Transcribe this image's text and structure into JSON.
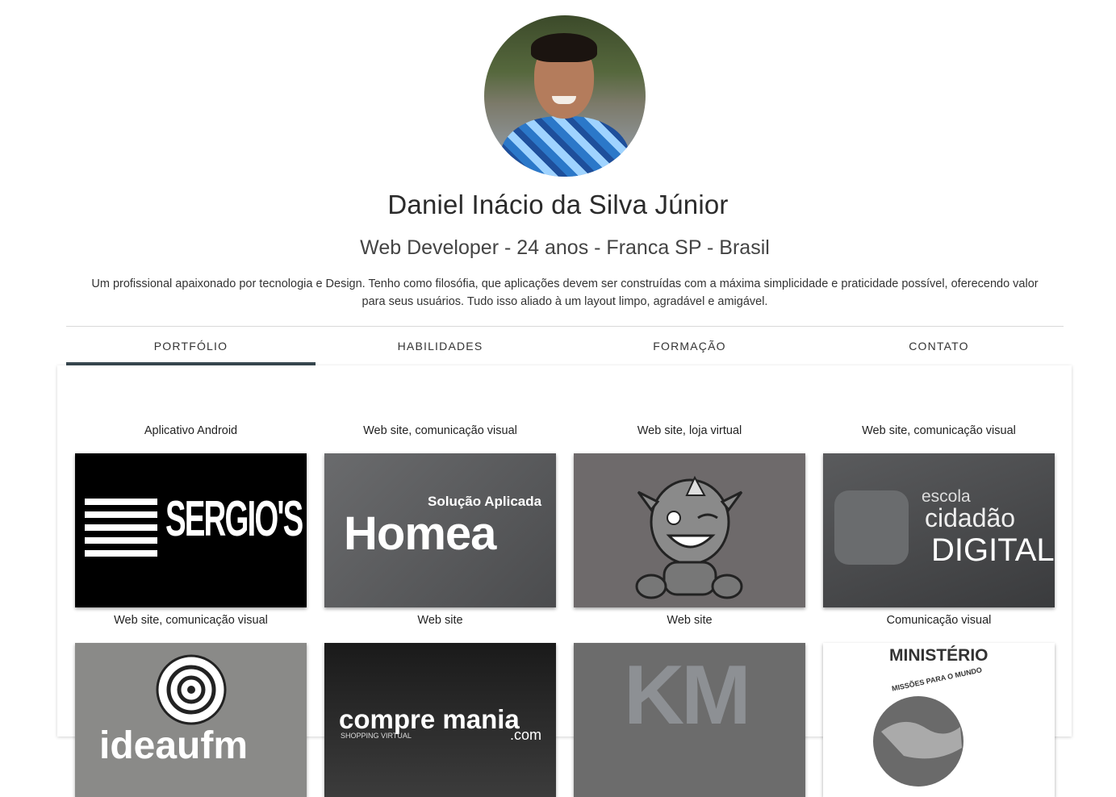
{
  "profile": {
    "name": "Daniel Inácio da Silva Júnior",
    "subtitle": "Web Developer - 24 anos - Franca SP - Brasil",
    "bio_line1": "Um profissional apaixonado por tecnologia e Design. Tenho como filosófia, que aplicações devem ser construídas com a máxima simplicidade e praticidade possível, oferecendo valor",
    "bio_line2": "para seus usuários. Tudo isso aliado à um layout limpo, agradável e amigável."
  },
  "tabs": [
    {
      "label": "PORTFÓLIO",
      "active": true
    },
    {
      "label": "HABILIDADES",
      "active": false
    },
    {
      "label": "FORMAÇÃO",
      "active": false
    },
    {
      "label": "CONTATO",
      "active": false
    }
  ],
  "portfolio": [
    {
      "caption": "Aplicativo Android",
      "logo": "SERGIO'S",
      "bg": "#000000"
    },
    {
      "caption": "Web site, comunicação visual",
      "logo": "Homea",
      "logo_sub": "Solução Aplicada",
      "bg": "#58595b"
    },
    {
      "caption": "Web site, loja virtual",
      "logo": "mascot",
      "bg": "#6e6a6b"
    },
    {
      "caption": "Web site, comunicação visual",
      "logo": "DIGITAL",
      "logo_sub": "escola",
      "logo_mid": "cidadão",
      "bg": "#4a4b4d"
    },
    {
      "caption": "Web site, comunicação visual",
      "logo": "ideaufm",
      "bg": "#8a8a88"
    },
    {
      "caption": "Web site",
      "logo": "compre mania",
      "logo_sub": "SHOPPING VIRTUAL",
      "logo_tail": ".com",
      "bg": "#2a2a2a"
    },
    {
      "caption": "Web site",
      "logo": "KM",
      "bg": "#6c6c6c"
    },
    {
      "caption": "Comunicação visual",
      "logo": "MINISTÉRIO",
      "logo_sub": "MISSÕES PARA O MUNDO",
      "bg": "#ffffff"
    }
  ]
}
